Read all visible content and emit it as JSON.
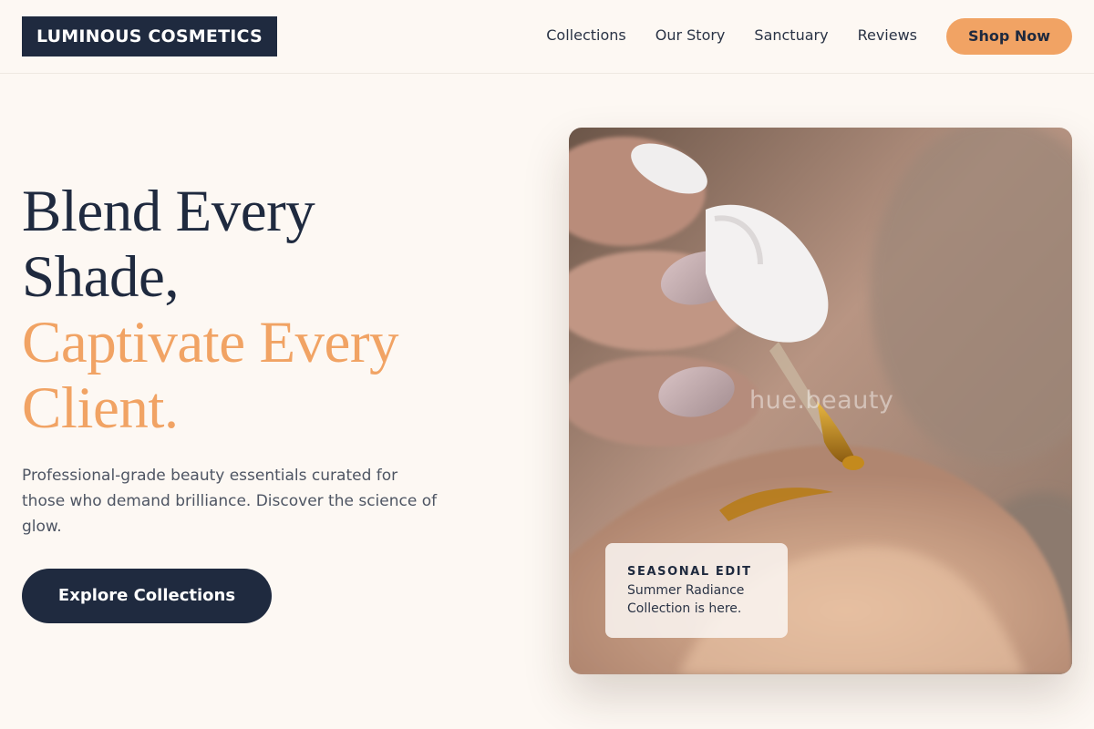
{
  "brand": {
    "logo": "LUMINOUS COSMETICS"
  },
  "nav": {
    "links": [
      "Collections",
      "Our Story",
      "Sanctuary",
      "Reviews"
    ],
    "cta": "Shop Now"
  },
  "hero": {
    "headline_dark": [
      "Blend Every",
      "Shade,"
    ],
    "headline_accent": [
      "Captivate Every",
      "Client."
    ],
    "subtext": "Professional-grade beauty essentials curated for those who demand brilliance. Discover the science of glow.",
    "cta": "Explore Collections"
  },
  "image_card": {
    "watermark": "hue.beauty",
    "promo_label": "SEASONAL EDIT",
    "promo_text": "Summer Radiance Collection is here."
  },
  "colors": {
    "navy": "#1f2a3f",
    "accent": "#f1a364",
    "background": "#fdf8f3"
  },
  "icons": []
}
